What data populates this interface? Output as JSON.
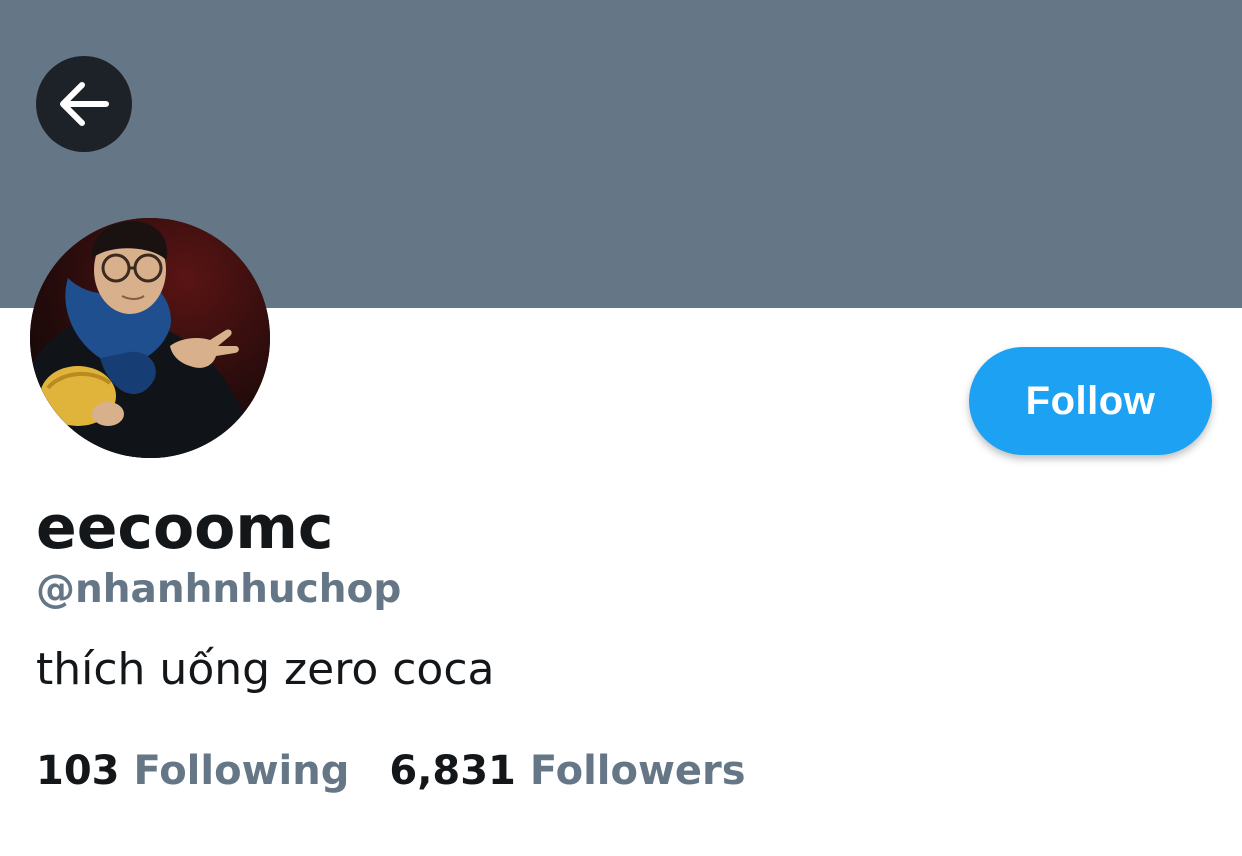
{
  "header": {
    "banner_color": "#657786",
    "back_icon": "arrow-left-icon"
  },
  "profile": {
    "avatar_icon": "profile-photo",
    "display_name": "eecoomc",
    "handle": "@nhanhnhuchop",
    "bio": "thích uống zero coca"
  },
  "actions": {
    "follow_label": "Follow",
    "follow_color": "#1da1f2"
  },
  "stats": {
    "following_count": "103",
    "following_label": "Following",
    "followers_count": "6,831",
    "followers_label": "Followers"
  }
}
